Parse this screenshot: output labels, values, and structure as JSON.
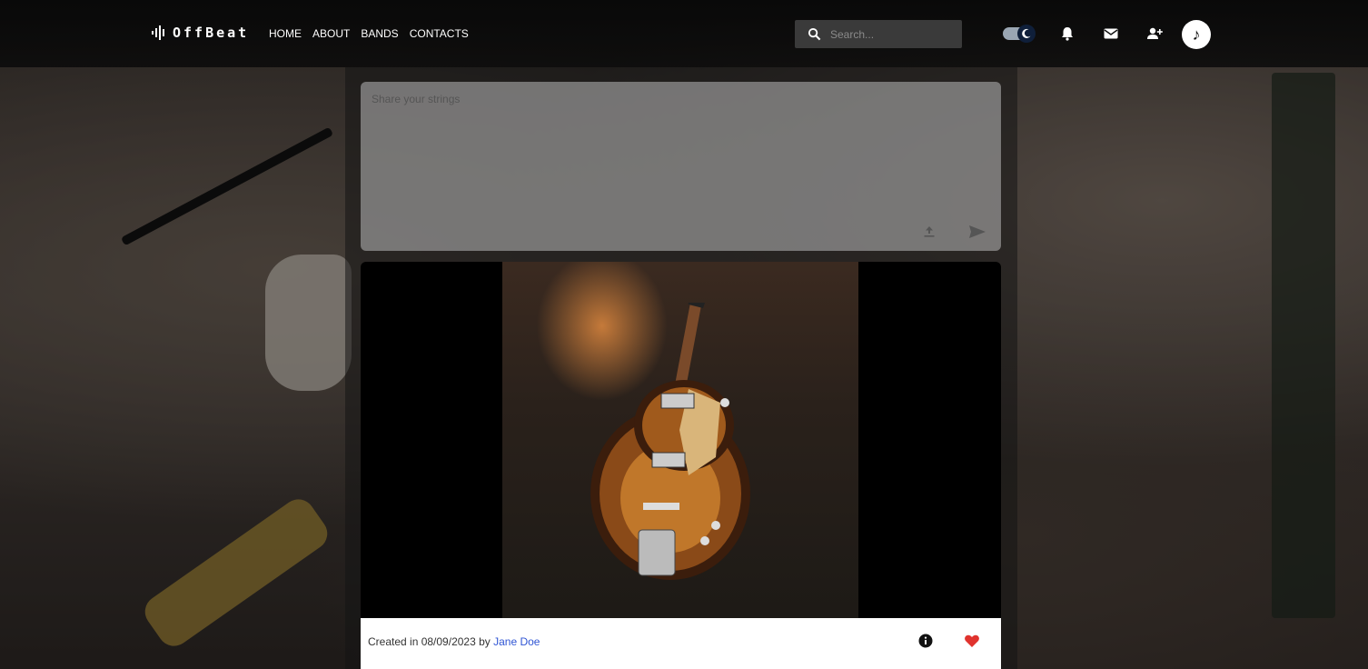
{
  "app": {
    "brand": "OffBeat"
  },
  "nav": {
    "links": [
      "HOME",
      "ABOUT",
      "BANDS",
      "CONTACTS"
    ]
  },
  "search": {
    "placeholder": "Search..."
  },
  "icons": {
    "brand": "waveform-icon",
    "search": "search-icon",
    "theme_toggle": "moon-icon",
    "notifications": "bell-icon",
    "messages": "mail-icon",
    "friends": "add-user-icon",
    "avatar": "music-note-icon",
    "upload": "upload-icon",
    "send": "send-icon",
    "info": "info-icon",
    "like": "heart-icon"
  },
  "colors": {
    "navbar": "#0a0a0a",
    "accent_link": "#2f55d4",
    "heart": "#e0332e"
  },
  "composer": {
    "placeholder": "Share your strings"
  },
  "post": {
    "created_prefix": "Created in 08/09/2023 by ",
    "author": "Jane Doe"
  }
}
